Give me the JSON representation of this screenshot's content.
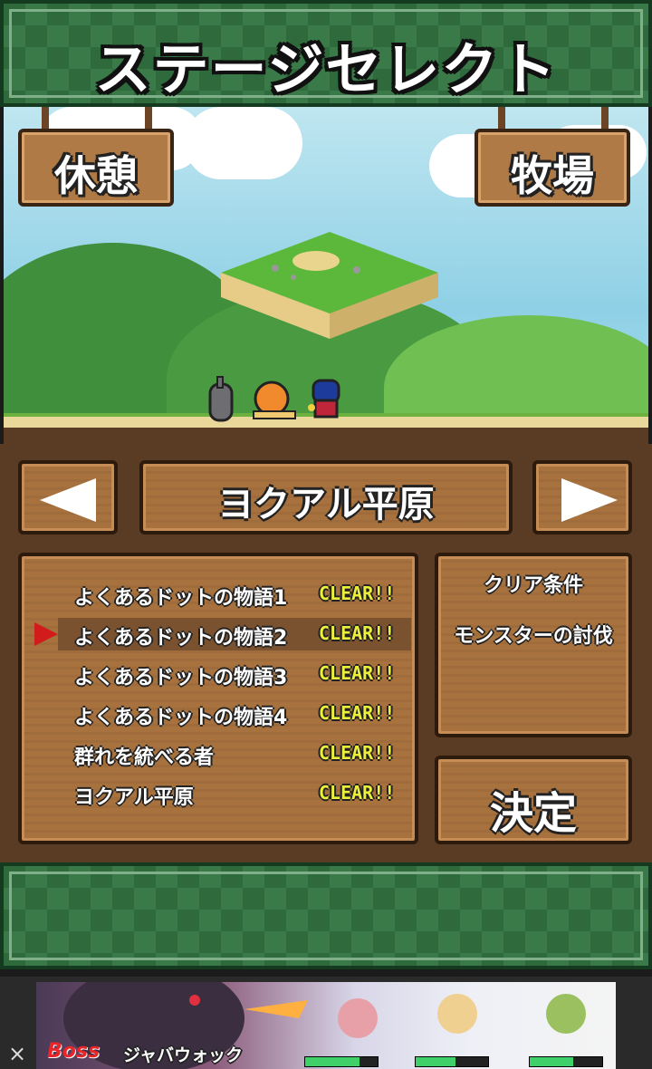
{
  "header": {
    "title": "ステージセレクト"
  },
  "scene": {
    "left_sign": "休憩",
    "right_sign": "牧場"
  },
  "stage_nav": {
    "prev_icon": "left-triangle",
    "next_icon": "right-triangle",
    "stage_name": "ヨクアル平原"
  },
  "stage_list": [
    {
      "name": "よくあるドットの物語1",
      "status": "CLEAR!!"
    },
    {
      "name": "よくあるドットの物語2",
      "status": "CLEAR!!"
    },
    {
      "name": "よくあるドットの物語3",
      "status": "CLEAR!!"
    },
    {
      "name": "よくあるドットの物語4",
      "status": "CLEAR!!"
    },
    {
      "name": "群れを統べる者",
      "status": "CLEAR!!"
    },
    {
      "name": "ヨクアル平原",
      "status": "CLEAR!!"
    }
  ],
  "selected_index": 1,
  "conditions": {
    "title": "クリア条件",
    "text": "モンスターの討伐"
  },
  "decide_label": "決定",
  "ad": {
    "boss_label": "Boss",
    "boss_name": "ジャバウォック",
    "close_icon": "×",
    "hp_levels": [
      0.75,
      0.55,
      0.6
    ]
  },
  "colors": {
    "accent_red": "#d21c1c",
    "clear_yellow": "#ecf03a",
    "wood": "#a8723f",
    "grass": "#2f6a3c"
  }
}
